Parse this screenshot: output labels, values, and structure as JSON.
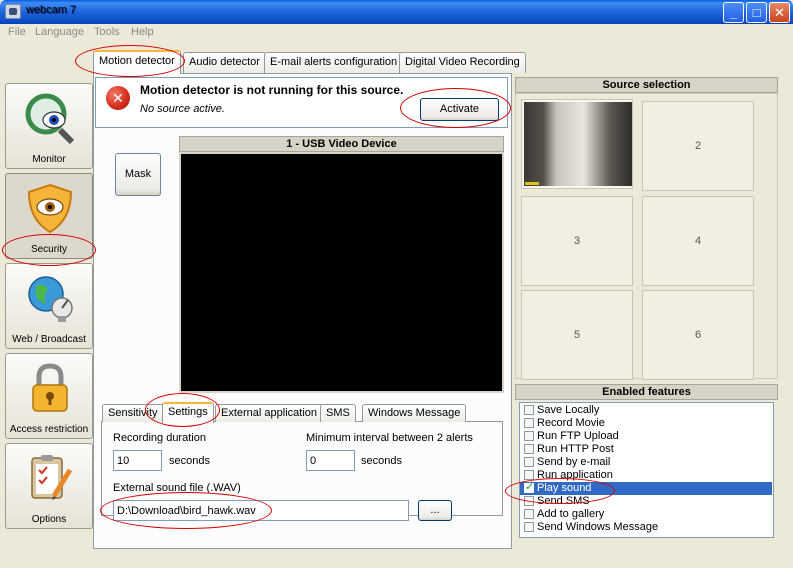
{
  "window": {
    "title": "webcam 7"
  },
  "menu": [
    "File",
    "Language",
    "Tools",
    "Help"
  ],
  "nav": [
    {
      "label": "Monitor",
      "icon": "magnifier-eye-icon"
    },
    {
      "label": "Security",
      "icon": "shield-eye-icon"
    },
    {
      "label": "Web / Broadcast",
      "icon": "globe-dish-icon"
    },
    {
      "label": "Access restriction",
      "icon": "padlock-icon"
    },
    {
      "label": "Options",
      "icon": "clipboard-pencil-icon"
    }
  ],
  "tabs": [
    "Motion detector",
    "Audio detector",
    "E-mail alerts configuration",
    "Digital Video Recording"
  ],
  "alert": {
    "title": "Motion detector is not running for this source.",
    "subtitle": "No source active.",
    "activate": "Activate"
  },
  "mask": "Mask",
  "video": {
    "title": "1 - USB Video Device"
  },
  "subtabs": [
    "Sensitivity",
    "Settings",
    "External application",
    "SMS",
    "Windows Message"
  ],
  "settings": {
    "recording_duration_label": "Recording duration",
    "recording_duration_value": "10",
    "seconds1": "seconds",
    "min_interval_label": "Minimum interval between 2 alerts",
    "min_interval_value": "0",
    "seconds2": "seconds",
    "sound_label": "External sound file (.WAV)",
    "sound_value": "D:\\Download\\bird_hawk.wav",
    "browse": "..."
  },
  "source": {
    "header": "Source selection",
    "cells": [
      "",
      "2",
      "3",
      "4",
      "5",
      "6"
    ]
  },
  "features": {
    "header": "Enabled features",
    "items": [
      {
        "label": "Save Locally",
        "checked": false
      },
      {
        "label": "Record Movie",
        "checked": false
      },
      {
        "label": "Run FTP Upload",
        "checked": false
      },
      {
        "label": "Run HTTP Post",
        "checked": false
      },
      {
        "label": "Send by e-mail",
        "checked": false
      },
      {
        "label": "Run application",
        "checked": false
      },
      {
        "label": "Play sound",
        "checked": true
      },
      {
        "label": "Send SMS",
        "checked": false
      },
      {
        "label": "Add to gallery",
        "checked": false
      },
      {
        "label": "Send Windows Message",
        "checked": false
      }
    ]
  },
  "colors": {
    "accent": "#316ac5",
    "annotation": "#d40000",
    "tab_highlight": "#f7b637"
  }
}
